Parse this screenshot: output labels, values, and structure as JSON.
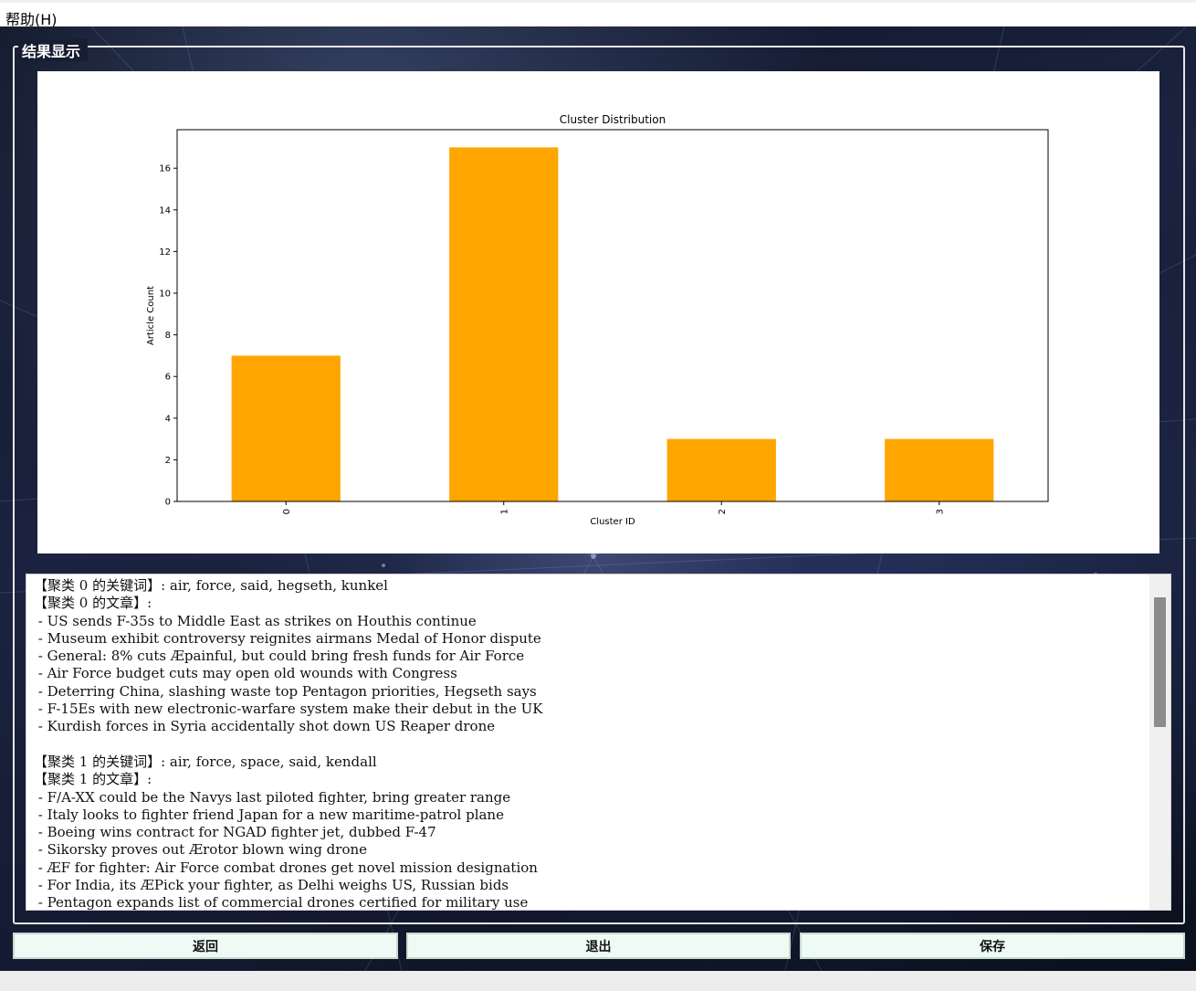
{
  "menu": {
    "help": "帮助(H)"
  },
  "groupbox": {
    "title": "结果显示"
  },
  "chart_data": {
    "type": "bar",
    "title": "Cluster Distribution",
    "xlabel": "Cluster ID",
    "ylabel": "Article Count",
    "categories": [
      "0",
      "1",
      "2",
      "3"
    ],
    "values": [
      7,
      17,
      3,
      3
    ],
    "ylim": [
      0,
      17.85
    ],
    "yticks": [
      0,
      2,
      4,
      6,
      8,
      10,
      12,
      14,
      16
    ],
    "color": "#ffa500",
    "grid": false,
    "legend": "none"
  },
  "results": {
    "lines": [
      "【聚类 0 的关键词】: air, force, said, hegseth, kunkel",
      "【聚类 0 的文章】:",
      " - US sends F-35s to Middle East as strikes on Houthis continue",
      " - Museum exhibit controversy reignites airmans Medal of Honor dispute",
      " - General: 8% cuts Æpainful, but could bring fresh funds for Air Force",
      " - Air Force budget cuts may open old wounds with Congress",
      " - Deterring China, slashing waste top Pentagon priorities, Hegseth says",
      " - F-15Es with new electronic-warfare system make their debut in the UK",
      " - Kurdish forces in Syria accidentally shot down US Reaper drone",
      "",
      "【聚类 1 的关键词】: air, force, space, said, kendall",
      "【聚类 1 的文章】:",
      " - F/A-XX could be the Navys last piloted fighter, bring greater range",
      " - Italy looks to fighter friend Japan for a new maritime-patrol plane",
      " - Boeing wins contract for NGAD fighter jet, dubbed F-47",
      " - Sikorsky proves out Ærotor blown wing drone",
      " - ÆF for fighter: Air Force combat drones get novel mission designation",
      " - For India, its ÆPick your fighter, as Delhi weighs US, Russian bids",
      " - Pentagon expands list of commercial drones certified for military use"
    ]
  },
  "buttons": {
    "back": "返回",
    "exit": "退出",
    "save": "保存"
  }
}
